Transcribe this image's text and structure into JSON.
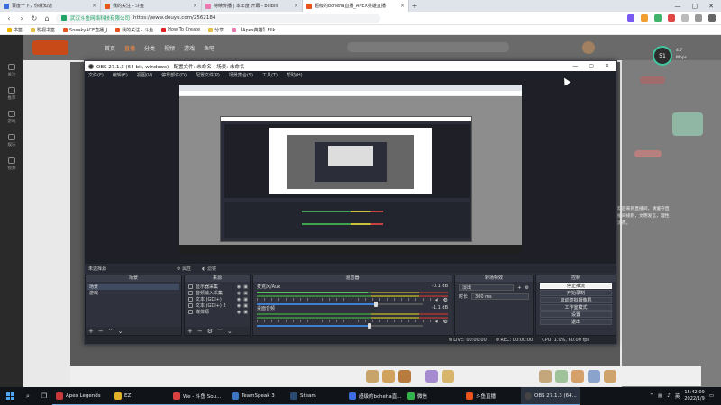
{
  "browser": {
    "tabs": [
      {
        "label": "百度一下，你就知道",
        "color": "#3b6de0"
      },
      {
        "label": "我的关注 - 斗鱼",
        "color": "#e9541e"
      },
      {
        "label": "持续传播 | 本年度 开幕 - bilibili",
        "color": "#e97ab0"
      },
      {
        "label": "超级的bcheha直播_APEX英雄直播",
        "color": "#e9541e",
        "active": true
      }
    ],
    "new_tab": "+",
    "window_controls": [
      "—",
      "▢",
      "✕"
    ],
    "address": {
      "site": "武汉斗鱼网络科技有限公司",
      "url": "https://www.douyu.com/2562184"
    },
    "bookmarks": [
      "书签",
      "影视书签",
      "SneakyACE直播_J",
      "我的关注 - 斗鱼",
      "How To Create",
      "分享",
      "【Apex英雄】Ellk"
    ]
  },
  "douyu": {
    "sidebar": [
      "关注",
      "推荐",
      "游戏",
      "娱乐",
      "视频"
    ],
    "header_nav": [
      "首页",
      "直播",
      "分类",
      "视频",
      "游戏",
      "鱼吧"
    ],
    "active_nav_index": 1,
    "fps": "51",
    "fps_info": [
      "4.7",
      "Mbps"
    ],
    "right_text": "欢迎来到直播间，请遵守直播间规则，文明发言，理性消费。"
  },
  "obs": {
    "title": "OBS 27.1.3 (64-bit, windows) - 配置文件: 未命名 - 场景: 未命名",
    "menu": [
      "文件(F)",
      "编辑(E)",
      "视图(V)",
      "停靠部件(D)",
      "配置文件(P)",
      "场景集合(S)",
      "工具(T)",
      "帮助(H)"
    ],
    "scene_bar": {
      "label": "未选择源",
      "properties": "属性",
      "filters": "滤镜"
    },
    "docks": {
      "scenes": {
        "title": "场景",
        "items": [
          "场景",
          "游戏"
        ]
      },
      "sources": {
        "title": "来源",
        "items": [
          "显示器采集",
          "音频输入采集",
          "文本 (GDI+)",
          "文本 (GDI+) 2",
          "媒体源"
        ]
      },
      "mixer": {
        "title": "混音器",
        "channels": [
          {
            "name": "麦克风/Aux",
            "db": "-0.1 dB",
            "level": 0.72
          },
          {
            "name": "桌面音频",
            "db": "-1.1 dB",
            "level": 0.68
          }
        ]
      },
      "transitions": {
        "title": "转场特效",
        "type": "淡出",
        "duration_label": "时长",
        "duration": "300 ms"
      },
      "controls": {
        "title": "控制",
        "buttons": [
          "停止推流",
          "开始录制",
          "启动虚拟摄像机",
          "工作室模式",
          "设置",
          "退出"
        ]
      }
    },
    "status": [
      "LIVE: 00:00:00",
      "REC: 00:00:00",
      "CPU: 1.0%, 60.00 fps"
    ]
  },
  "taskbar": {
    "apps": [
      {
        "label": "Apex Legends",
        "color": "#c83b3b"
      },
      {
        "label": "EZ",
        "color": "#e0b02a"
      },
      {
        "label": "We - 斗鱼 Sou...",
        "color": "#d94040"
      },
      {
        "label": "TeamSpeak 3",
        "color": "#3a76c4"
      },
      {
        "label": "Steam",
        "color": "#1b2838"
      },
      {
        "label": "超级的bcheha直...",
        "color": "#3b6de0"
      },
      {
        "label": "微信",
        "color": "#2fb34a"
      },
      {
        "label": "斗鱼直播",
        "color": "#e9541e"
      },
      {
        "label": "OBS 27.1.3 (64...",
        "color": "#444",
        "active": true
      }
    ],
    "tray_lang": "英",
    "time": "15:42:09",
    "date": "2022/1/9"
  }
}
